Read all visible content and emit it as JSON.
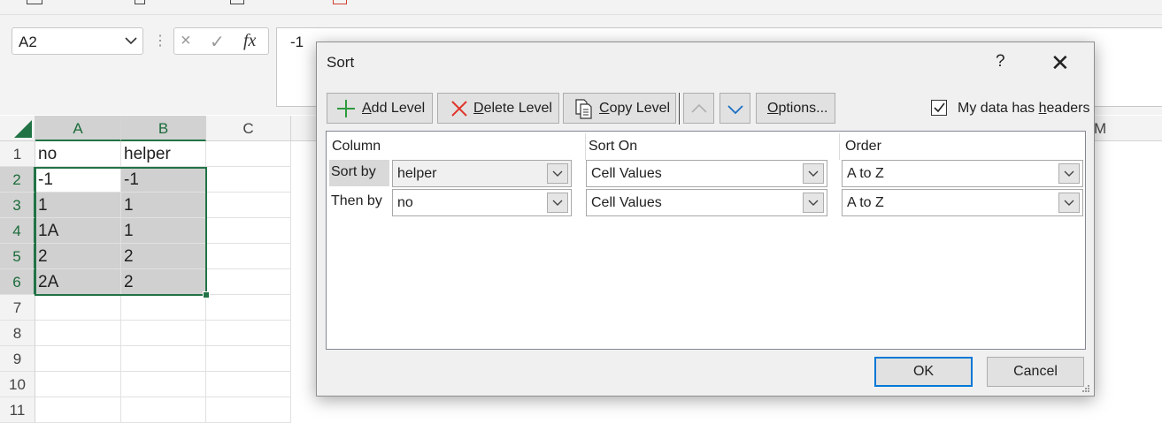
{
  "formula_bar": {
    "name_box": "A2",
    "fx": "fx",
    "cancel": "×",
    "confirm": "✓",
    "content": "-1"
  },
  "sheet": {
    "columns": [
      "A",
      "B",
      "C",
      "M"
    ],
    "rows": [
      "1",
      "2",
      "3",
      "4",
      "5",
      "6",
      "7",
      "8",
      "9",
      "10",
      "11"
    ],
    "cells": [
      [
        "no",
        "helper"
      ],
      [
        "-1",
        "-1"
      ],
      [
        "1",
        "1"
      ],
      [
        "1A",
        "1"
      ],
      [
        "2",
        "2"
      ],
      [
        "2A",
        "2"
      ]
    ]
  },
  "dialog": {
    "title": "Sort",
    "help": "?",
    "close": "✕",
    "toolbar": {
      "add_level_prefix": "",
      "add_level_u": "A",
      "add_level_rest": "dd Level",
      "delete_level_u": "D",
      "delete_level_rest": "elete Level",
      "copy_level_u": "C",
      "copy_level_rest": "opy Level",
      "options_u": "O",
      "options_rest": "ptions..."
    },
    "headers_checkbox": {
      "checked": true,
      "label_pre": "My data has ",
      "label_u": "h",
      "label_rest": "eaders"
    },
    "columns": {
      "column": "Column",
      "sort_on": "Sort On",
      "order": "Order"
    },
    "levels": [
      {
        "label": "Sort by",
        "column": "helper",
        "sort_on": "Cell Values",
        "order": "A to Z"
      },
      {
        "label": "Then by",
        "column": "no",
        "sort_on": "Cell Values",
        "order": "A to Z"
      }
    ],
    "ok": "OK",
    "cancel": "Cancel"
  },
  "colors": {
    "excel_green": "#217346",
    "selection_fill": "#d0d0d0",
    "focus_blue": "#0078d7"
  }
}
